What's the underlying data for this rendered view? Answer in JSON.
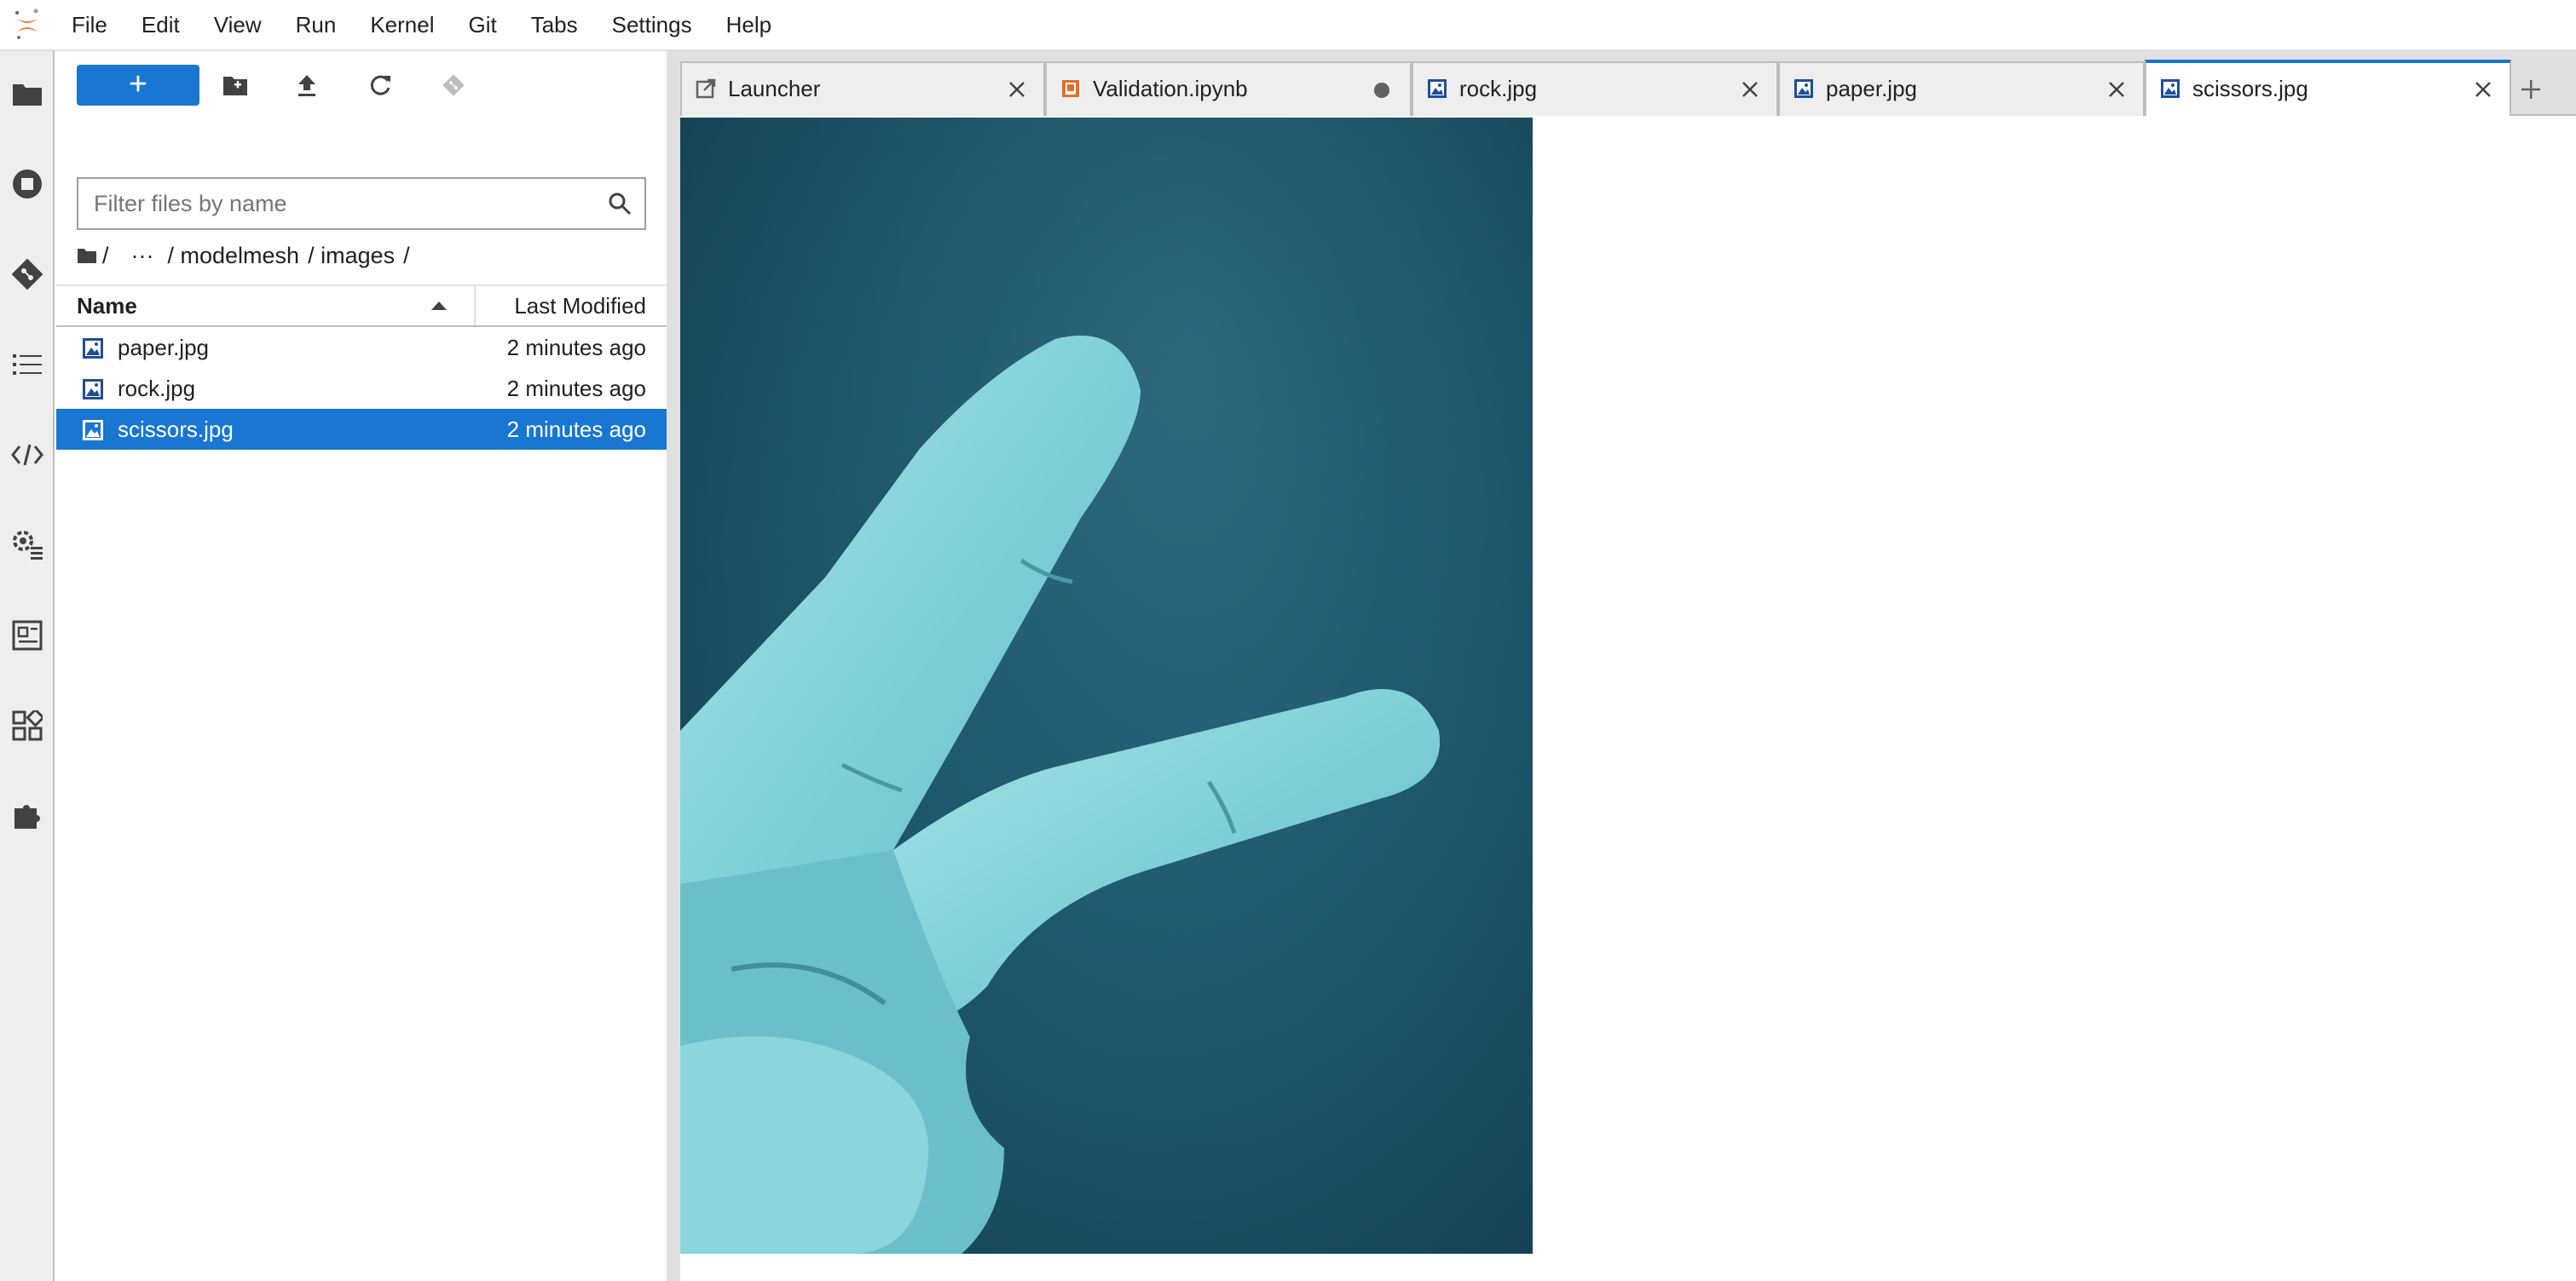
{
  "menu": [
    "File",
    "Edit",
    "View",
    "Run",
    "Kernel",
    "Git",
    "Tabs",
    "Settings",
    "Help"
  ],
  "activity_icons": [
    "folder-icon",
    "running-icon",
    "git-icon",
    "toc-icon",
    "code-icon",
    "property-inspector-icon",
    "debugger-icon",
    "extension-manager-icon",
    "puzzle-icon"
  ],
  "filebrowser": {
    "filter_placeholder": "Filter files by name",
    "breadcrumb": {
      "root": "/",
      "ellipsis": "···",
      "parts": [
        "/ modelmesh",
        "/ images",
        "/"
      ]
    },
    "columns": {
      "name": "Name",
      "modified": "Last Modified"
    },
    "files": [
      {
        "name": "paper.jpg",
        "modified": "2 minutes ago",
        "selected": false
      },
      {
        "name": "rock.jpg",
        "modified": "2 minutes ago",
        "selected": false
      },
      {
        "name": "scissors.jpg",
        "modified": "2 minutes ago",
        "selected": true
      }
    ],
    "new_label": "+"
  },
  "tabs": [
    {
      "label": "Launcher",
      "icon": "launcher-icon",
      "active": false,
      "dirty": false
    },
    {
      "label": "Validation.ipynb",
      "icon": "notebook-icon",
      "active": false,
      "dirty": true
    },
    {
      "label": "rock.jpg",
      "icon": "image-icon",
      "active": false,
      "dirty": false
    },
    {
      "label": "paper.jpg",
      "icon": "image-icon",
      "active": false,
      "dirty": false
    },
    {
      "label": "scissors.jpg",
      "icon": "image-icon",
      "active": true,
      "dirty": false
    }
  ],
  "colors": {
    "accent": "#1976d2",
    "selected_row": "#1976d2",
    "image_icon": "#1f4e99",
    "notebook_icon": "#e46e2e",
    "logo": "#f37726"
  }
}
